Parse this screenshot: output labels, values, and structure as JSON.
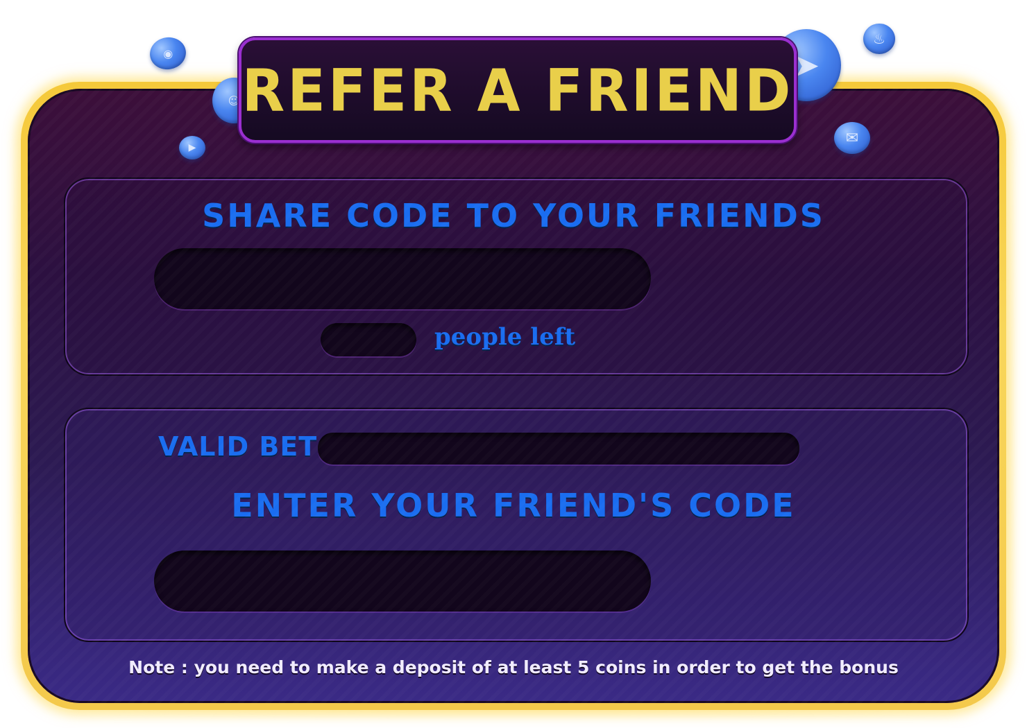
{
  "title": "REFER A FRIEND",
  "share_section": {
    "heading": "SHARE CODE TO YOUR FRIENDS",
    "code_value": "",
    "people_left_value": "",
    "people_left_label": "people left"
  },
  "enter_section": {
    "valid_bet_label": "VALID BET",
    "valid_bet_value": "",
    "heading": "ENTER YOUR FRIEND'S CODE",
    "friend_code_value": ""
  },
  "note": "Note : you need to make a deposit of at least 5 coins in order to get the bonus",
  "icons": [
    "discord-icon",
    "user-icon",
    "youtube-icon",
    "telegram-icon",
    "bell-icon",
    "mail-icon"
  ],
  "colors": {
    "gold": "#e9cf4a",
    "blue_text": "#1a6df0",
    "panel_top": "#3c0f3a",
    "panel_bottom": "#3a2a86",
    "plate_border": "#9a2fd0"
  }
}
